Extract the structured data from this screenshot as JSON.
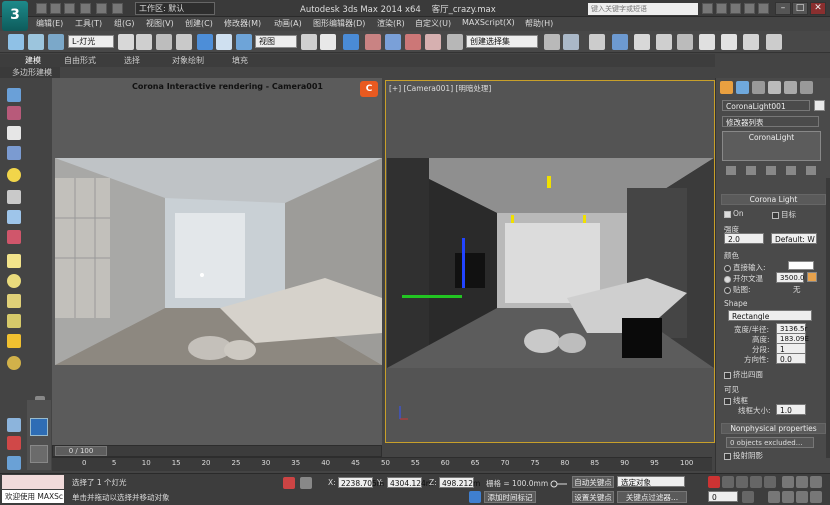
{
  "title_bar": {
    "logo_text": "3",
    "workspace": "工作区: 默认",
    "app_title": "Autodesk 3ds Max  2014 x64",
    "file_name": "客厅_crazy.max",
    "search_placeholder": "键入关键字或短语",
    "minimize": "–",
    "maximize": "□",
    "close": "✕"
  },
  "menu": [
    "编辑(E)",
    "工具(T)",
    "组(G)",
    "视图(V)",
    "创建(C)",
    "修改器(M)",
    "动画(A)",
    "图形编辑器(D)",
    "渲染(R)",
    "自定义(U)",
    "MAXScript(X)",
    "帮助(H)"
  ],
  "toolbar": {
    "selection_filter": "L-灯光",
    "reference_coord": "视图",
    "named_selection": "创建选择集"
  },
  "ribbon": {
    "tabs": [
      "建模",
      "自由形式",
      "选择",
      "对象绘制",
      "填充"
    ],
    "active_tab": "建模",
    "sub_label": "多边形建模"
  },
  "render_window": {
    "title": "Corona Interactive rendering - Camera001",
    "logo": "C"
  },
  "viewport": {
    "label": "[+] [Camera001] [明暗处理]"
  },
  "command_panel": {
    "object_name": "CoronaLight001",
    "modifier_list": "修改器列表",
    "stack_item": "CoronaLight",
    "rollout_corona_light": "Corona Light",
    "on_label": "On",
    "target_label": "目标",
    "intensity_label": "强度",
    "intensity_value": "2.0",
    "intensity_unit": "Default: W",
    "color_label": "颜色",
    "direct_input": "直接输入:",
    "kelvin_label": "开尔文温",
    "kelvin_value": "3500.0",
    "texmap_label": "贴图:",
    "texmap_value": "无",
    "shape_label": "Shape",
    "shape_value": "Rectangle",
    "width_label": "宽度/半径:",
    "width_value": "3136.5r",
    "height_label": "高度:",
    "height_value": "183.09E",
    "segments_label": "分段:",
    "segments_value": "1",
    "directionality_label": "方向性:",
    "directionality_value": "0.0",
    "occlude_label": "挤出四面",
    "visible_label": "可见",
    "wire_label": "线框",
    "wire_size_label": "线框大小:",
    "wire_size_value": "1.0",
    "rollout_nonphysical": "Nonphysical properties",
    "excluded_text": "0 objects excluded...",
    "cast_shadows": "投射阴影",
    "accent_color": "#e7a24d"
  },
  "timeline": {
    "slider_text": "0 / 100",
    "ticks": [
      "0",
      "5",
      "10",
      "15",
      "20",
      "25",
      "30",
      "35",
      "40",
      "45",
      "50",
      "55",
      "60",
      "65",
      "70",
      "75",
      "80",
      "85",
      "90",
      "95",
      "100"
    ]
  },
  "status": {
    "maxscript_label": "欢迎使用 MAXSc",
    "selected_text": "选择了 1 个灯光",
    "prompt_text": "单击并拖动以选择并移动对象",
    "x_label": "X:",
    "x_value": "2238.705m",
    "y_label": "Y:",
    "y_value": "4304.124m",
    "z_label": "Z:",
    "z_value": "498.212m",
    "grid_text": "栅格 = 100.0mm",
    "auto_key": "自动关键点",
    "set_key": "设置关键点",
    "key_filter_select": "选定对象",
    "key_filters": "关键点过滤器...",
    "add_time_tag": "添加时间标记",
    "frame_value": "0"
  }
}
